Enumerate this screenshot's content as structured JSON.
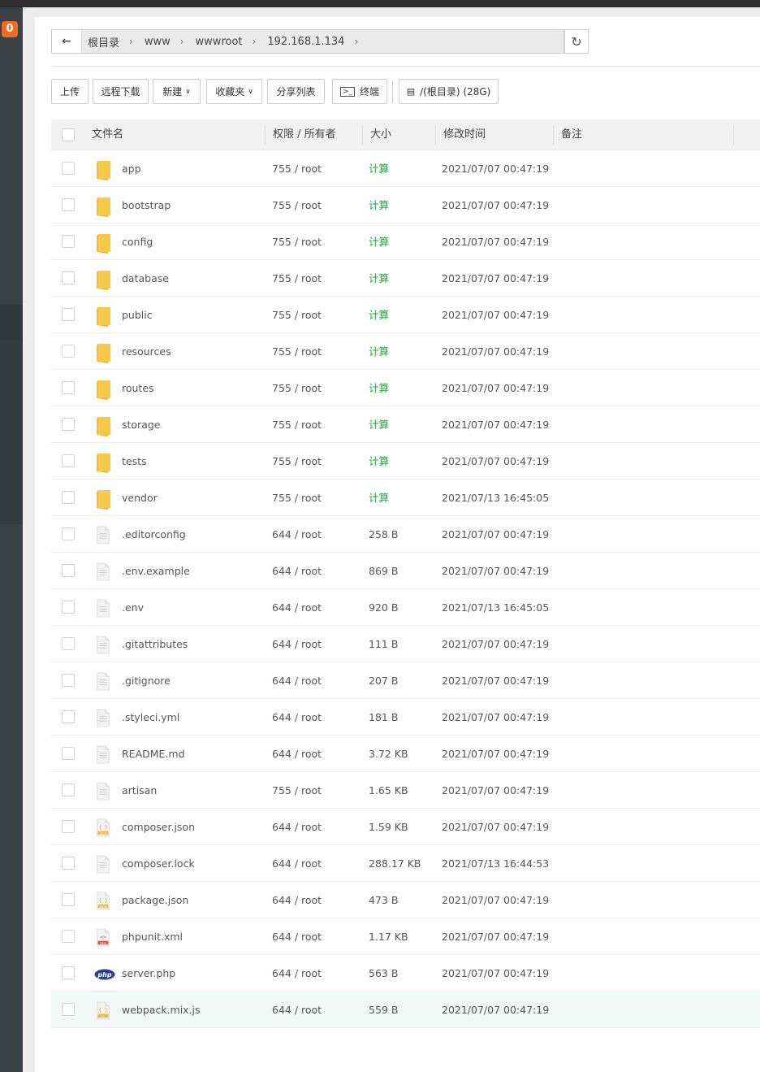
{
  "sidebar": {
    "badge": "0"
  },
  "breadcrumb": [
    "根目录",
    "www",
    "wwwroot",
    "192.168.1.134"
  ],
  "toolbar": {
    "upload": "上传",
    "remote_download": "远程下载",
    "new": "新建",
    "favorites": "收藏夹",
    "share_list": "分享列表",
    "terminal": "终端",
    "disk": "/(根目录) (28G)"
  },
  "table": {
    "headers": {
      "name": "文件名",
      "perm": "权限 / 所有者",
      "size": "大小",
      "mtime": "修改时间",
      "note": "备注"
    },
    "rows": [
      {
        "name": "app",
        "perm": "755 / root",
        "size": "计算",
        "mtime": "2021/07/07 00:47:19",
        "type": "folder"
      },
      {
        "name": "bootstrap",
        "perm": "755 / root",
        "size": "计算",
        "mtime": "2021/07/07 00:47:19",
        "type": "folder"
      },
      {
        "name": "config",
        "perm": "755 / root",
        "size": "计算",
        "mtime": "2021/07/07 00:47:19",
        "type": "folder"
      },
      {
        "name": "database",
        "perm": "755 / root",
        "size": "计算",
        "mtime": "2021/07/07 00:47:19",
        "type": "folder"
      },
      {
        "name": "public",
        "perm": "755 / root",
        "size": "计算",
        "mtime": "2021/07/07 00:47:19",
        "type": "folder"
      },
      {
        "name": "resources",
        "perm": "755 / root",
        "size": "计算",
        "mtime": "2021/07/07 00:47:19",
        "type": "folder"
      },
      {
        "name": "routes",
        "perm": "755 / root",
        "size": "计算",
        "mtime": "2021/07/07 00:47:19",
        "type": "folder"
      },
      {
        "name": "storage",
        "perm": "755 / root",
        "size": "计算",
        "mtime": "2021/07/07 00:47:19",
        "type": "folder"
      },
      {
        "name": "tests",
        "perm": "755 / root",
        "size": "计算",
        "mtime": "2021/07/07 00:47:19",
        "type": "folder"
      },
      {
        "name": "vendor",
        "perm": "755 / root",
        "size": "计算",
        "mtime": "2021/07/13 16:45:05",
        "type": "folder"
      },
      {
        "name": ".editorconfig",
        "perm": "644 / root",
        "size": "258 B",
        "mtime": "2021/07/07 00:47:19",
        "type": "file"
      },
      {
        "name": ".env.example",
        "perm": "644 / root",
        "size": "869 B",
        "mtime": "2021/07/07 00:47:19",
        "type": "file"
      },
      {
        "name": ".env",
        "perm": "644 / root",
        "size": "920 B",
        "mtime": "2021/07/13 16:45:05",
        "type": "file"
      },
      {
        "name": ".gitattributes",
        "perm": "644 / root",
        "size": "111 B",
        "mtime": "2021/07/07 00:47:19",
        "type": "file"
      },
      {
        "name": ".gitignore",
        "perm": "644 / root",
        "size": "207 B",
        "mtime": "2021/07/07 00:47:19",
        "type": "file"
      },
      {
        "name": ".styleci.yml",
        "perm": "644 / root",
        "size": "181 B",
        "mtime": "2021/07/07 00:47:19",
        "type": "file"
      },
      {
        "name": "README.md",
        "perm": "644 / root",
        "size": "3.72 KB",
        "mtime": "2021/07/07 00:47:19",
        "type": "file"
      },
      {
        "name": "artisan",
        "perm": "755 / root",
        "size": "1.65 KB",
        "mtime": "2021/07/07 00:47:19",
        "type": "file"
      },
      {
        "name": "composer.json",
        "perm": "644 / root",
        "size": "1.59 KB",
        "mtime": "2021/07/07 00:47:19",
        "type": "json"
      },
      {
        "name": "composer.lock",
        "perm": "644 / root",
        "size": "288.17 KB",
        "mtime": "2021/07/13 16:44:53",
        "type": "file"
      },
      {
        "name": "package.json",
        "perm": "644 / root",
        "size": "473 B",
        "mtime": "2021/07/07 00:47:19",
        "type": "json"
      },
      {
        "name": "phpunit.xml",
        "perm": "644 / root",
        "size": "1.17 KB",
        "mtime": "2021/07/07 00:47:19",
        "type": "xml"
      },
      {
        "name": "server.php",
        "perm": "644 / root",
        "size": "563 B",
        "mtime": "2021/07/07 00:47:19",
        "type": "php"
      },
      {
        "name": "webpack.mix.js",
        "perm": "644 / root",
        "size": "559 B",
        "mtime": "2021/07/07 00:47:19",
        "type": "js"
      }
    ]
  },
  "icon_labels": {
    "json": "JSON",
    "xml": "XML",
    "js": "JS",
    "php": "php"
  },
  "colors": {
    "accent_green": "#20a53a",
    "badge_orange": "#f26c1f",
    "folder_yellow": "#f7c948"
  }
}
